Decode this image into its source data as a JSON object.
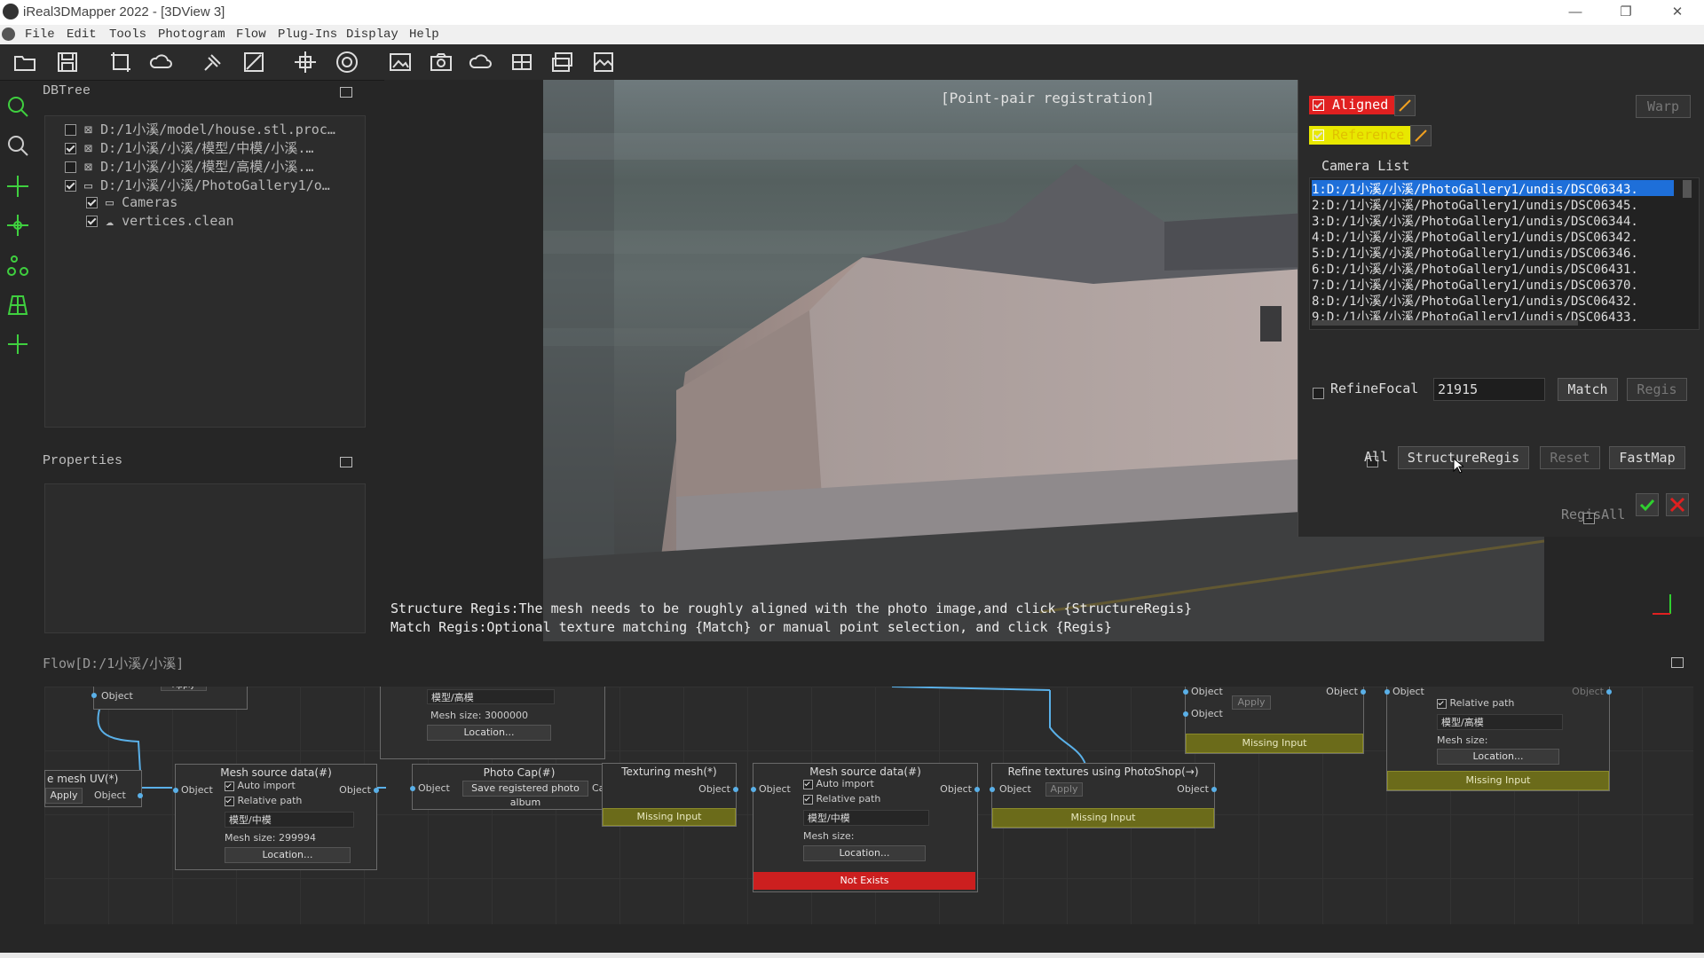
{
  "window": {
    "title": "iReal3DMapper 2022 - [3DView 3]",
    "min": "—",
    "restore": "❐",
    "close": "✕"
  },
  "menu": [
    "File",
    "Edit",
    "Tools",
    "Photogram",
    "Flow",
    "Plug-Ins",
    "Display",
    "Help"
  ],
  "dbtree": {
    "title": "DBTree",
    "items": [
      {
        "label": "D:/1小溪/model/house.stl.proc…",
        "checked": false,
        "icon": "mesh-icon"
      },
      {
        "label": "D:/1小溪/小溪/模型/中模/小溪.…",
        "checked": true,
        "icon": "mesh-icon"
      },
      {
        "label": "D:/1小溪/小溪/模型/高模/小溪.…",
        "checked": false,
        "icon": "mesh-icon"
      },
      {
        "label": "D:/1小溪/小溪/PhotoGallery1/o…",
        "checked": true,
        "icon": "folder-icon"
      },
      {
        "label": "Cameras",
        "checked": true,
        "icon": "folder-icon"
      },
      {
        "label": "vertices.clean",
        "checked": true,
        "icon": "cloud-icon"
      }
    ]
  },
  "properties": {
    "title": "Properties"
  },
  "view3d": {
    "banner": "[Point-pair registration]",
    "hint1": "Structure Regis:The mesh needs to be roughly aligned with the photo image,and click {StructureRegis}",
    "hint2": "Match Regis:Optional texture matching {Match} or manual point selection, and click {Regis}"
  },
  "regpanel": {
    "aligned": "Aligned",
    "reference": "Reference",
    "warp": "Warp",
    "camera_list_title": "Camera List",
    "cameras": [
      "1:D:/1小溪/小溪/PhotoGallery1/undis/DSC06343.",
      "2:D:/1小溪/小溪/PhotoGallery1/undis/DSC06345.",
      "3:D:/1小溪/小溪/PhotoGallery1/undis/DSC06344.",
      "4:D:/1小溪/小溪/PhotoGallery1/undis/DSC06342.",
      "5:D:/1小溪/小溪/PhotoGallery1/undis/DSC06346.",
      "6:D:/1小溪/小溪/PhotoGallery1/undis/DSC06431.",
      "7:D:/1小溪/小溪/PhotoGallery1/undis/DSC06370.",
      "8:D:/1小溪/小溪/PhotoGallery1/undis/DSC06432.",
      "9:D:/1小溪/小溪/PhotoGallery1/undis/DSC06433."
    ],
    "refine_focal": "RefineFocal",
    "focal_value": "21915",
    "match": "Match",
    "regis": "Regis",
    "all": "All",
    "structure_regis": "StructureRegis",
    "reset": "Reset",
    "fastmap": "FastMap",
    "regis_all": "RegisAll"
  },
  "flow": {
    "title": "Flow[D:/1小溪/小溪]",
    "object": "Object",
    "apply": "Apply",
    "auto_import": "Auto import",
    "relative_path": "Relative path",
    "location": "Location...",
    "missing_input": "Missing Input",
    "mesh_size": "Mesh size:",
    "node_mesh_uv": "e mesh UV(*)",
    "node_mesh_source1": "Mesh source data(#)",
    "node_mesh_source1_path": "模型/中模",
    "node_mesh_source1_size": "Mesh size: 299994",
    "node_top_path": "模型/高模",
    "node_top_size": "Mesh size: 3000000",
    "node_photo_cap": "Photo Cap(#)",
    "node_photo_cap_btn": "Save registered photo album",
    "node_photo_cap_port": "Cap",
    "node_texturing": "Texturing mesh(*)",
    "node_mesh_source2": "Mesh source data(#)",
    "node_mesh_source2_path": "模型/中模",
    "not_exists": "Not Exists",
    "node_refine": "Refine textures using PhotoShop(→)",
    "node_right_path": "模型/高模"
  },
  "colors": {
    "accent": "#1e6fd9",
    "aligned": "#e02020",
    "reference": "#e8e800",
    "missing": "#6b6b1a",
    "not_exists": "#cc1f1f",
    "port": "#5ab0e8"
  }
}
